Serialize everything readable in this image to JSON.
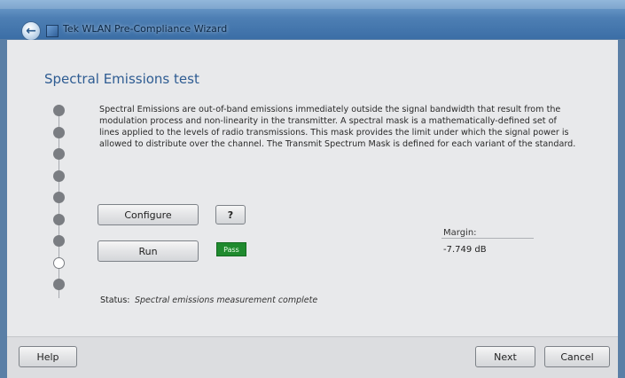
{
  "window": {
    "title": "Tek WLAN Pre-Compliance Wizard"
  },
  "page": {
    "title": "Spectral Emissions test",
    "description": "Spectral Emissions are out-of-band emissions immediately outside the signal bandwidth that result from the modulation process and non-linearity in the transmitter. A spectral mask is a mathematically-defined set of lines applied to the levels of radio transmissions. This mask provides the limit under which the signal power is allowed to distribute over the channel. The Transmit Spectrum Mask is defined for each variant of the standard."
  },
  "steps": {
    "count": 9,
    "current_step": 8
  },
  "actions": {
    "configure_label": "Configure",
    "help_q_label": "?",
    "run_label": "Run",
    "pass_label": "Pass"
  },
  "result": {
    "margin_label": "Margin:",
    "margin_value": "-7.749 dB"
  },
  "status": {
    "label": "Status:",
    "text": "Spectral emissions measurement complete"
  },
  "footer": {
    "help_label": "Help",
    "next_label": "Next",
    "cancel_label": "Cancel"
  },
  "colors": {
    "title_blue": "#2e5c92",
    "pass_green": "#1f8a2e"
  },
  "icons": {
    "back": "back-arrow-icon",
    "app": "app-icon"
  }
}
